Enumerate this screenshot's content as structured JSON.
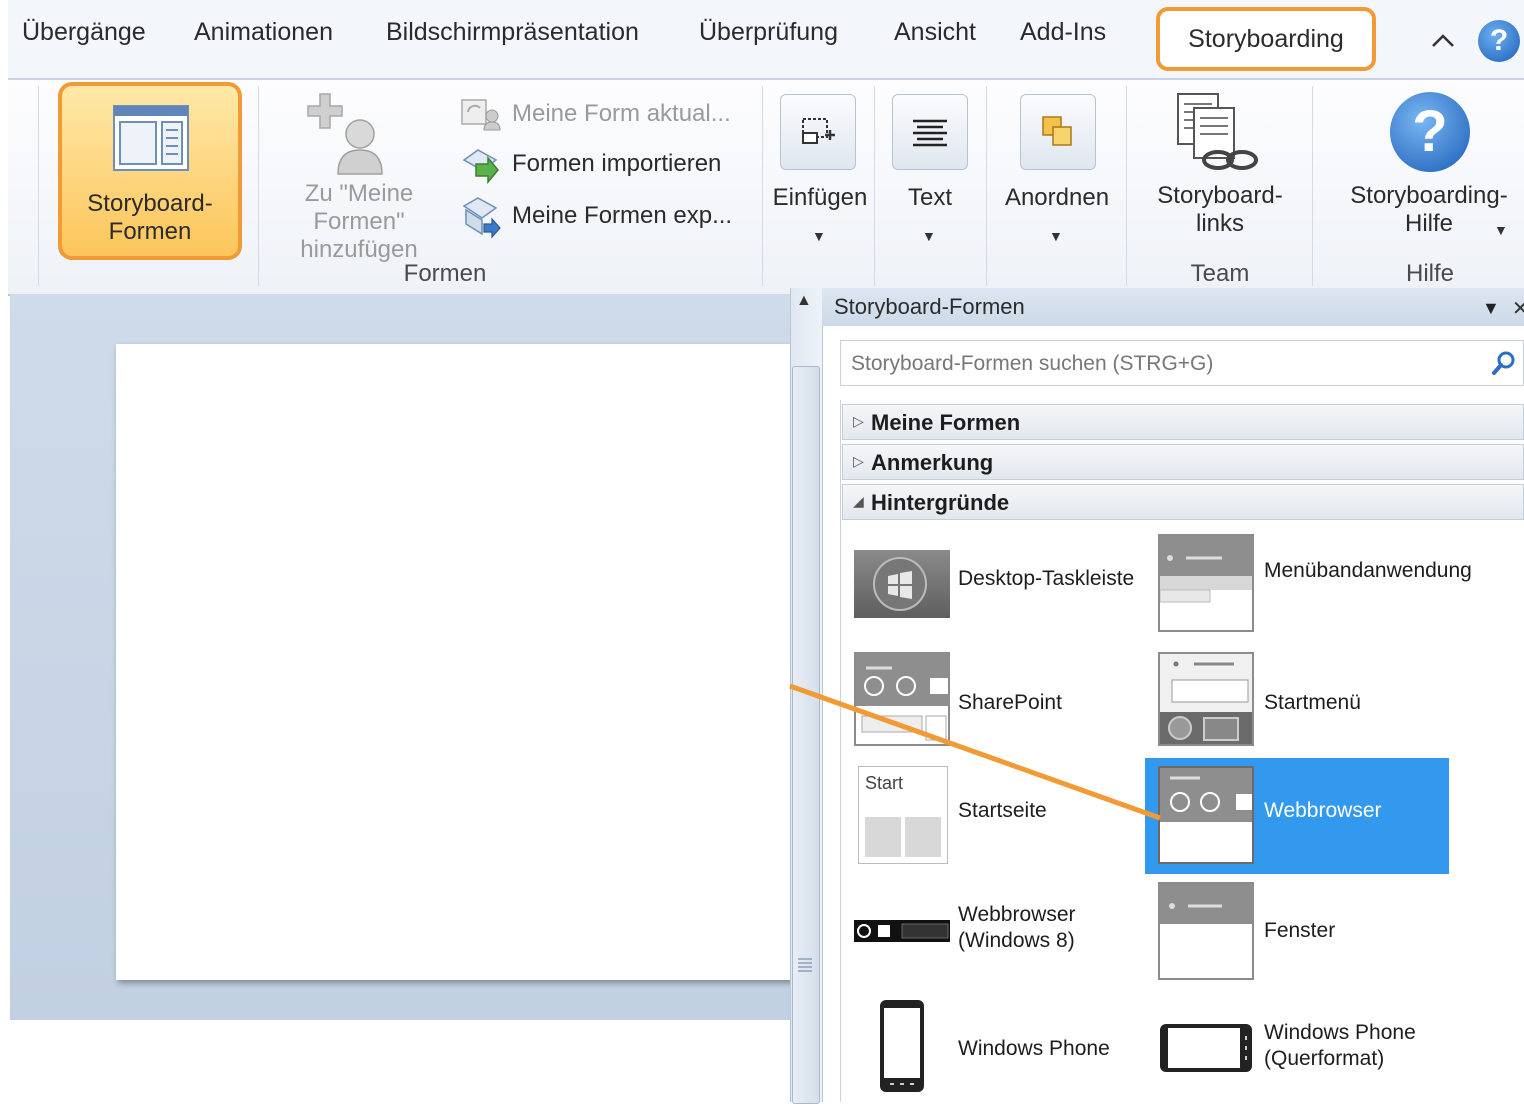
{
  "tabs": [
    "Übergänge",
    "Animationen",
    "Bildschirmpräsentation",
    "Überprüfung",
    "Ansicht",
    "Add-Ins"
  ],
  "active_tab": "Storyboarding",
  "ribbon": {
    "storyboard_forms": {
      "line1": "Storyboard-",
      "line2": "Formen"
    },
    "add_to_my_shapes": {
      "line1": "Zu \"Meine",
      "line2": "Formen\"",
      "line3": "hinzufügen"
    },
    "update_shape": "Meine Form aktual...",
    "import_shapes": "Formen importieren",
    "export_shapes": "Meine Formen exp...",
    "group_forms": "Formen",
    "insert": "Einfügen",
    "text": "Text",
    "arrange": "Anordnen",
    "storyboard_links": {
      "line1": "Storyboard-",
      "line2": "links"
    },
    "group_team": "Team",
    "help": {
      "line1": "Storyboarding-",
      "line2": "Hilfe"
    },
    "group_help": "Hilfe"
  },
  "pane": {
    "title": "Storyboard-Formen",
    "search_placeholder": "Storyboard-Formen suchen (STRG+G)",
    "categories": [
      {
        "name": "Meine Formen",
        "expanded": false
      },
      {
        "name": "Anmerkung",
        "expanded": false
      },
      {
        "name": "Hintergründe",
        "expanded": true
      }
    ],
    "shapes": {
      "desktop_taskbar": "Desktop-Taskleiste",
      "ribbon_app": "Menübandanwendung",
      "sharepoint": "SharePoint",
      "start_menu": "Startmenü",
      "start_page": "Startseite",
      "start_page_thumb_text": "Start",
      "webbrowser": "Webbrowser",
      "webbrowser_win8_line1": "Webbrowser",
      "webbrowser_win8_line2": "(Windows 8)",
      "window": "Fenster",
      "windows_phone": "Windows Phone",
      "windows_phone_landscape_line1": "Windows Phone",
      "windows_phone_landscape_line2": "(Querformat)"
    },
    "selected_shape": "Webbrowser"
  },
  "colors": {
    "highlight_orange": "#f29a36",
    "selection_blue": "#3399ee",
    "ribbon_bg": "#eef2f7"
  },
  "icons": [
    "collapse-ribbon-icon",
    "help-icon",
    "search-icon",
    "pane-dropdown-icon",
    "pane-close-icon",
    "windows-logo-icon"
  ]
}
